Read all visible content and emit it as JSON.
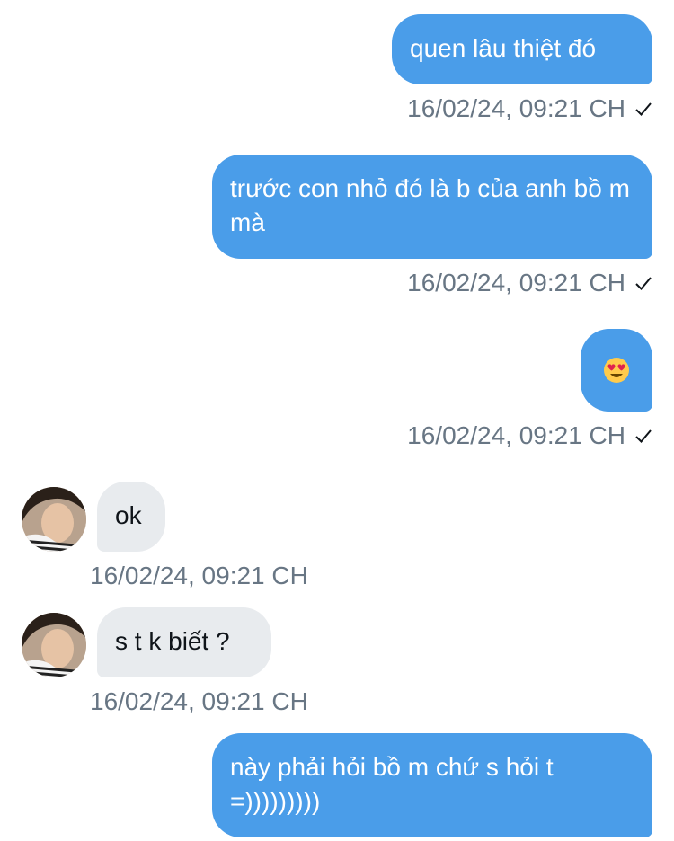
{
  "messages": [
    {
      "direction": "out",
      "text": "quen lâu thiệt đó",
      "time": "16/02/24, 09:21 CH",
      "read_icon": "check-icon"
    },
    {
      "direction": "out",
      "text": "trước con nhỏ đó là b của anh bồ m mà",
      "time": "16/02/24, 09:21 CH",
      "read_icon": "check-icon"
    },
    {
      "direction": "out",
      "text": "",
      "emoji": "heart-eyes-emoji",
      "time": "16/02/24, 09:21 CH",
      "read_icon": "check-icon"
    },
    {
      "direction": "in",
      "text": "ok",
      "time": "16/02/24, 09:21 CH",
      "avatar": "avatar"
    },
    {
      "direction": "in",
      "text": "s t k biết ?",
      "time": "16/02/24, 09:21 CH",
      "avatar": "avatar"
    },
    {
      "direction": "out",
      "text": "này phải hỏi bồ m chứ s hỏi t =)))))))))"
    }
  ],
  "colors": {
    "outgoing_bubble": "#4a9de9",
    "incoming_bubble": "#e8ebee",
    "timestamp": "#687684"
  }
}
